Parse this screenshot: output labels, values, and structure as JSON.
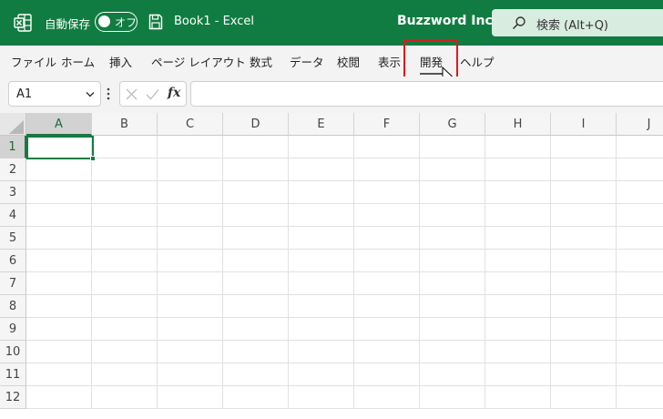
{
  "titlebar": {
    "autosave_label": "自動保存",
    "toggle_state": "オフ",
    "document_title": "Book1  -  Excel",
    "account": "Buzzword Inc.",
    "search_placeholder": "検索 (Alt+Q)"
  },
  "ribbon": {
    "tabs": [
      "ファイル",
      "ホーム",
      "挿入",
      "ページ レイアウト",
      "数式",
      "データ",
      "校閲",
      "表示",
      "開発",
      "ヘルプ"
    ]
  },
  "formula_bar": {
    "name_box": "A1",
    "formula": ""
  },
  "grid": {
    "columns": [
      "A",
      "B",
      "C",
      "D",
      "E",
      "F",
      "G",
      "H",
      "I",
      "J"
    ],
    "rows": [
      "1",
      "2",
      "3",
      "4",
      "5",
      "6",
      "7",
      "8",
      "9",
      "10",
      "11",
      "12"
    ],
    "selected_cell": "A1"
  },
  "colors": {
    "brand": "#107c41",
    "highlight": "#e0191a"
  },
  "icons": {
    "app": "excel-icon",
    "save": "save-icon",
    "search": "search-icon",
    "cancel": "x-icon",
    "enter": "check-icon",
    "function": "fx-icon"
  }
}
